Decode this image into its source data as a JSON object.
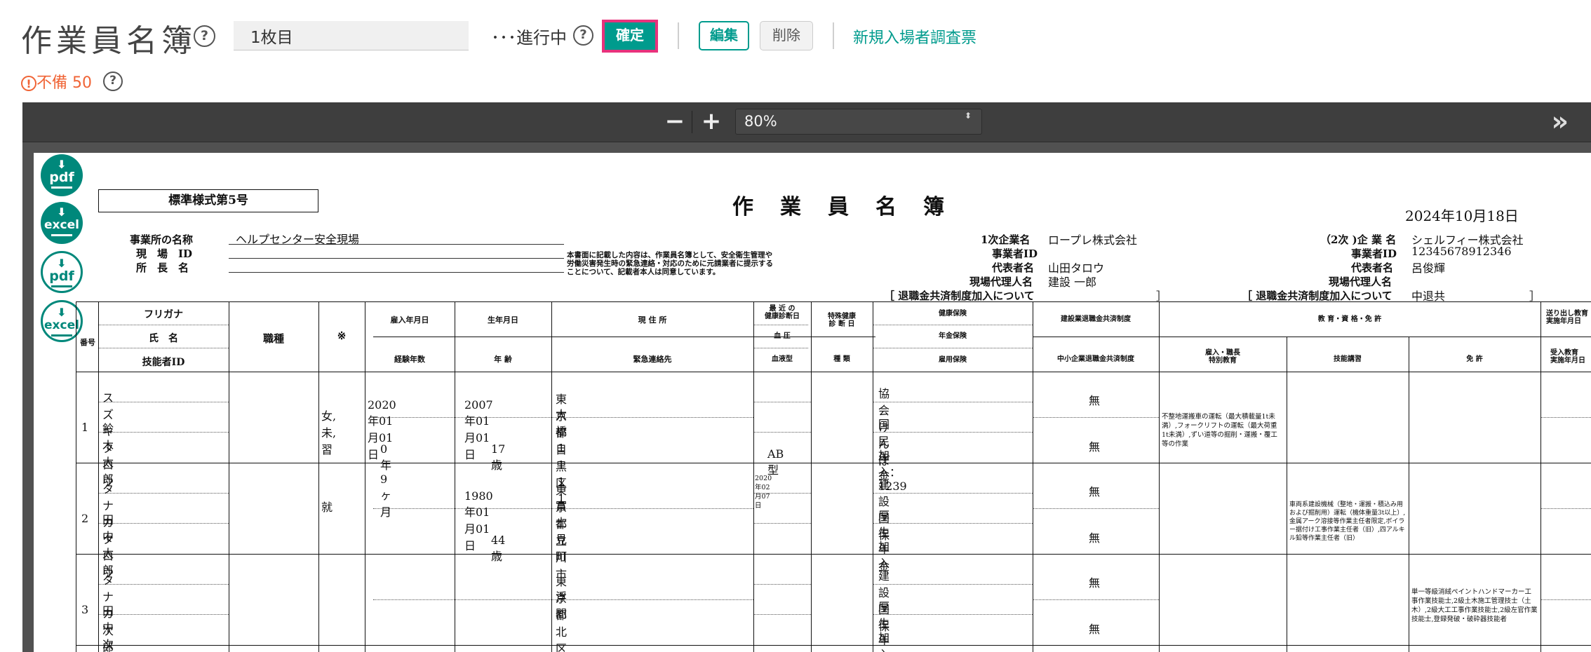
{
  "header": {
    "title": "作業員名簿",
    "sheet_value": "1枚目",
    "status_label": "･･･進行中",
    "confirm_label": "確定",
    "edit_label": "編集",
    "delete_label": "削除",
    "new_link": "新規入場者調査票",
    "help_glyph": "?"
  },
  "warning": {
    "icon_glyph": "!",
    "text": "不備 50"
  },
  "viewer": {
    "zoom_out": "−",
    "zoom_in": "+",
    "zoom": "80%",
    "sidebar_toggle": "»",
    "select_arrow": "⬍"
  },
  "downloads": [
    {
      "label": "pdf",
      "style": "filled"
    },
    {
      "label": "excel",
      "style": "filled"
    },
    {
      "label": "pdf",
      "style": "outline"
    },
    {
      "label": "excel",
      "style": "outline"
    }
  ],
  "document": {
    "form_no": "標準様式第5号",
    "title": "作業員名簿",
    "date": "2024年10月18日",
    "labels": {
      "office_name": "事業所の名称",
      "site_id": "現　場　ID",
      "chief_name": "所　長　名"
    },
    "office_name": "ヘルプセンター安全現場",
    "notice": [
      "本書面に記載した内容は、作業員名簿として、安全衛生管理や",
      "労働災害発生時の緊急連絡・対応のために元請業者に提示する",
      "ことについて、記載者本人は同意しています。"
    ],
    "primary": {
      "company_label": "1次企業名",
      "company": "ロープレ株式会社",
      "bizid_label": "事業者ID",
      "bizid": "",
      "rep_label": "代表者名",
      "rep": "山田タロウ",
      "agent_label": "現場代理人名",
      "agent": "建設 一郎",
      "retire_label": "［ 退職金共済制度加入について",
      "retire_value": "］"
    },
    "secondary": {
      "company_label": "（2次 )企 業 名",
      "company": "シェルフィー株式会社",
      "bizid_label": "事業者ID",
      "bizid": "12345678912346",
      "rep_label": "代表者名",
      "rep": "呂俊輝",
      "agent_label": "現場代理人名",
      "agent": "",
      "retire_label": "［ 退職金共済制度加入について",
      "retire_value": "中退共",
      "retire_close": "］"
    },
    "columns": {
      "no": "番号",
      "furigana": "フリガナ",
      "name": "氏　名",
      "skill_id": "技能者ID",
      "job": "職種",
      "mark": "※",
      "hire_date": "雇入年月日",
      "experience": "経験年数",
      "birth": "生年月日",
      "age": "年 齢",
      "address": "現 住 所",
      "emergency": "緊急連絡先",
      "latest_check": [
        "最 近 の",
        "健康診断日"
      ],
      "blood_pressure": "血 圧",
      "blood_type": "血液型",
      "special_check": [
        "特殊健康",
        "診 断 日"
      ],
      "special_kind": "種 類",
      "health_ins": "健康保険",
      "pension": "年金保険",
      "employment_ins": "雇用保険",
      "construction_retire": "建設業退職金共済制度",
      "sme_retire": "中小企業退職金共済制度",
      "education": "教 育・資 格・免 許",
      "special_edu": [
        "雇入・職長",
        "特別教育"
      ],
      "skill_training": "技能講習",
      "license": "免 許",
      "send_edu": [
        "送り出し教育",
        "実施年月日"
      ],
      "accept_edu": [
        "受入教育",
        "実施年月日"
      ]
    },
    "rows": [
      {
        "no": "1",
        "furigana": "スズキタロウ",
        "name": "鈴木太郎",
        "mark": "女,未,習",
        "hire_date": "2020年01月01日",
        "experience": "0年9ヶ月",
        "birth": "2007年01月01日",
        "age": "17歳",
        "address": [
          "東京都目黒区",
          "大橋１１１１"
        ],
        "checkup_date": "",
        "blood_type": "AB型",
        "health_ins": "協会けんぽ",
        "pension": "国民年金",
        "employment": "加入： 1239",
        "retire1": "無",
        "retire2": "無",
        "special_edu": "不整地運搬車の運転（最大積載量1t未満）,フォークリフトの運転（最大荷重1t未満）,ずい道等の掘削・運搬・覆工等の作業",
        "skill_training": "",
        "license": ""
      },
      {
        "no": "2",
        "furigana": "タナカタロウ",
        "name": "田中太郎",
        "mark": "就",
        "hire_date": "",
        "experience": "",
        "birth": "1980年01月01日",
        "age": "44歳",
        "address": [
          "東京都立川市",
          "富士見町"
        ],
        "checkup_date": "2020年02月07日",
        "blood_type": "",
        "health_ins": "建設国保",
        "pension": "厚生年金",
        "employment": "加入",
        "retire1": "無",
        "retire2": "無",
        "special_edu": "",
        "skill_training": "車両系建設機械（整地・運搬・積込み用および掘削用）運転（機体重量3t以上）,金属アーク溶接等作業主任者限定,ボイラー据付け工事作業主任者（旧）,四アルキル鉛等作業主任者（旧）",
        "license": ""
      },
      {
        "no": "3",
        "furigana": "タナカ次郎",
        "name": "田中次郎",
        "mark": "",
        "hire_date": "",
        "experience": "",
        "birth": "",
        "age": "",
        "address": [
          "東京都北区",
          "浮間"
        ],
        "checkup_date": "",
        "blood_type": "",
        "health_ins": "建設国保",
        "pension": "厚生年金",
        "employment": "加入",
        "retire1": "無",
        "retire2": "無",
        "special_edu": "",
        "skill_training": "",
        "license": "単一等級消絨ペイントハンドマーカー工事作業技能士,2級土木施工管理技士（土木）,2級大工工事作業技能士,2級左官作業技能士,登録発破・破砕器技能者"
      }
    ]
  }
}
